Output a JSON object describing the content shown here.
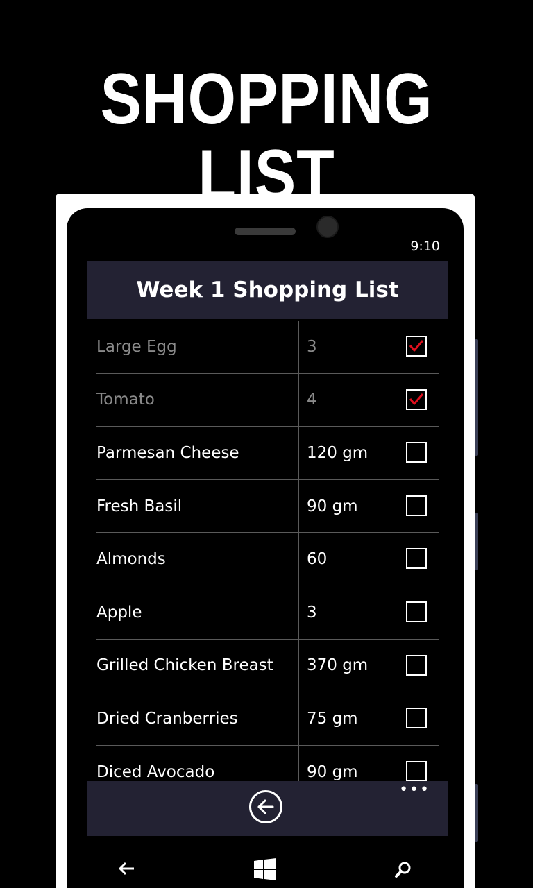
{
  "banner": {
    "title": "SHOPPING LIST"
  },
  "status": {
    "time": "9:10"
  },
  "header": {
    "title": "Week 1 Shopping List"
  },
  "items": [
    {
      "name": "Large Egg",
      "qty": "3",
      "checked": true
    },
    {
      "name": "Tomato",
      "qty": "4",
      "checked": true
    },
    {
      "name": "Parmesan Cheese",
      "qty": "120 gm",
      "checked": false
    },
    {
      "name": "Fresh Basil",
      "qty": "90 gm",
      "checked": false
    },
    {
      "name": "Almonds",
      "qty": "60",
      "checked": false
    },
    {
      "name": "Apple",
      "qty": "3",
      "checked": false
    },
    {
      "name": "Grilled Chicken Breast",
      "qty": "370 gm",
      "checked": false
    },
    {
      "name": "Dried Cranberries",
      "qty": "75 gm",
      "checked": false
    },
    {
      "name": "Diced Avocado",
      "qty": "90 gm",
      "checked": false
    }
  ],
  "app_bar": {
    "more": "•••"
  },
  "icons": {
    "app_back": "back-arrow-circle-icon",
    "nav_back": "nav-back-icon",
    "nav_home": "windows-logo-icon",
    "nav_search": "search-icon"
  },
  "colors": {
    "background": "#000000",
    "header_bg": "#232233",
    "check_mark": "#e0101e",
    "frame": "#ffffff"
  }
}
